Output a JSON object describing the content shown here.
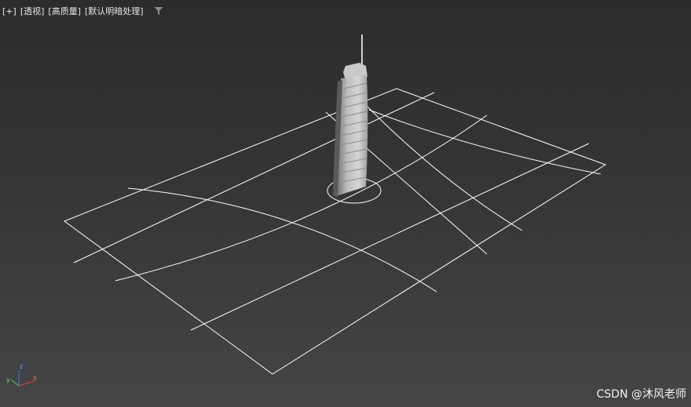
{
  "viewport": {
    "menu_plus": "[+]",
    "menu_view": "[透视]",
    "menu_shading": "[高质量]",
    "menu_lighting": "[默认明暗处理]",
    "filter_icon": "funnel-icon"
  },
  "gizmo": {
    "x": "x",
    "y": "y",
    "z": "z"
  },
  "watermark": "CSDN @沐风老师",
  "colors": {
    "background_top": "#2c2c2c",
    "background_bottom": "#454545",
    "wireframe": "#ffffff",
    "axis_x": "#d23b3b",
    "axis_y": "#3bbf3b",
    "axis_z": "#3b6fe0"
  }
}
